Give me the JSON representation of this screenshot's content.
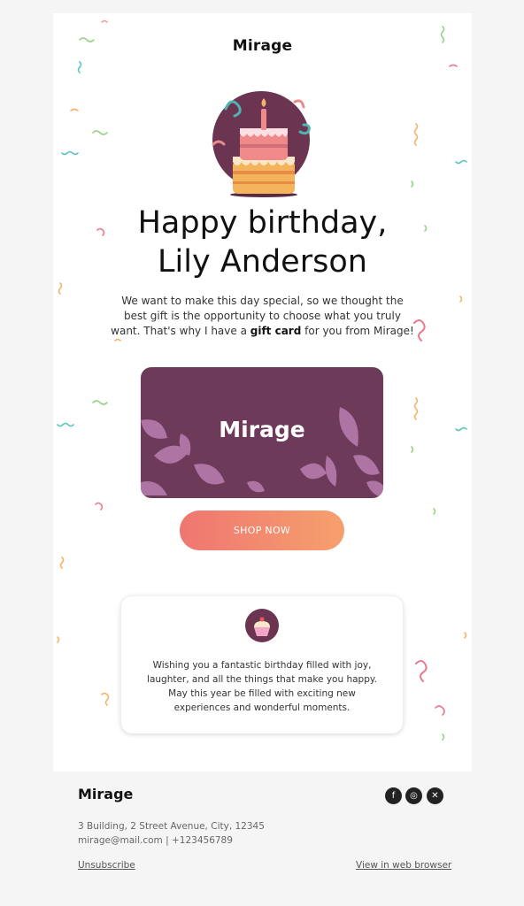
{
  "brand": {
    "logo_text": "Mirage"
  },
  "hero": {
    "title_line1": "Happy birthday,",
    "title_line2": "Lily Anderson",
    "icon": "birthday-cake-icon"
  },
  "intro": {
    "text_before": "We want to make this day special, so we thought the best gift is the opportunity to choose what you truly want. That's why I have a ",
    "bold": "gift card",
    "text_after": " for you from Mirage!"
  },
  "gift_card": {
    "logo_text": "Mirage",
    "background_color": "#6e3a5a"
  },
  "cta": {
    "label": "SHOP NOW",
    "gradient": [
      "#ef7671",
      "#f6a06d"
    ]
  },
  "wish": {
    "icon": "cupcake-icon",
    "text": "Wishing you a fantastic birthday filled with joy, laughter, and all the things that make you happy. May this year be filled with exciting new experiences and wonderful moments."
  },
  "footer": {
    "logo_text": "Mirage",
    "address": "3 Building, 2 Street Avenue, City, 12345",
    "contact": "mirage@mail.com | +123456789",
    "unsubscribe": "Unsubscribe",
    "view_in_browser": "View in web browser",
    "social": [
      {
        "name": "facebook-icon",
        "glyph": "f"
      },
      {
        "name": "instagram-icon",
        "glyph": "◎"
      },
      {
        "name": "x-icon",
        "glyph": "✕"
      }
    ]
  }
}
